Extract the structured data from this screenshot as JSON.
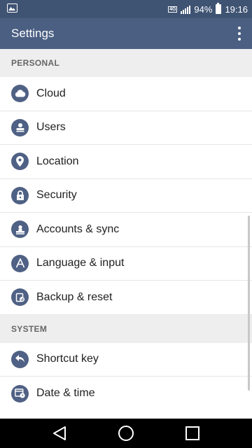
{
  "status_bar": {
    "network": "4G",
    "battery": "94%",
    "time": "19:16"
  },
  "app_bar": {
    "title": "Settings",
    "menu_icon": "more-vert-icon"
  },
  "sections": [
    {
      "header": "PERSONAL",
      "items": [
        {
          "label": "Cloud",
          "icon": "cloud-icon"
        },
        {
          "label": "Users",
          "icon": "users-icon"
        },
        {
          "label": "Location",
          "icon": "location-pin-icon"
        },
        {
          "label": "Security",
          "icon": "lock-icon"
        },
        {
          "label": "Accounts & sync",
          "icon": "accounts-icon"
        },
        {
          "label": "Language & input",
          "icon": "language-icon"
        },
        {
          "label": "Backup & reset",
          "icon": "backup-icon"
        }
      ]
    },
    {
      "header": "SYSTEM",
      "items": [
        {
          "label": "Shortcut key",
          "icon": "shortcut-arrow-icon"
        },
        {
          "label": "Date & time",
          "icon": "calendar-clock-icon"
        }
      ]
    }
  ],
  "colors": {
    "status_bar": "#3f5373",
    "app_bar": "#4a5f82",
    "icon_bg": "#4f6184",
    "section_bg": "#eeeeee"
  }
}
